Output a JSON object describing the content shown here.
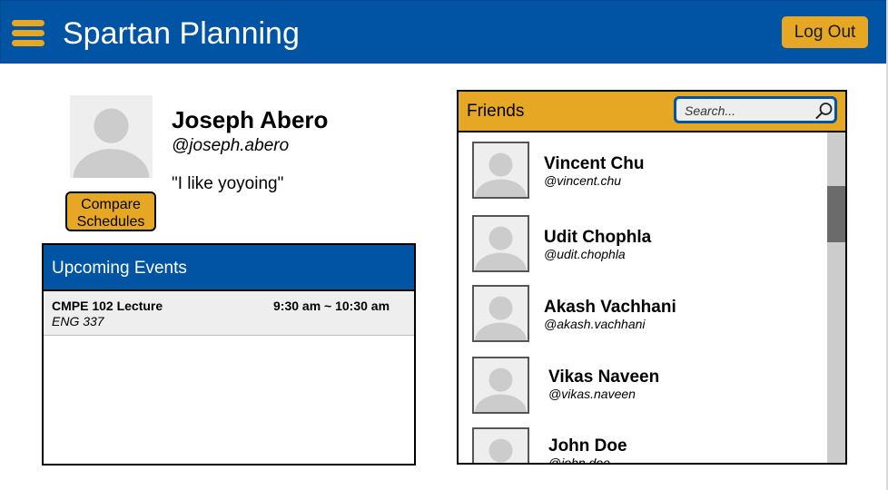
{
  "header": {
    "title": "Spartan Planning",
    "logout_label": "Log Out",
    "menu_icon": "hamburger-menu-icon"
  },
  "colors": {
    "primary_blue": "#0054a3",
    "accent_gold": "#e6a824",
    "panel_gray": "#eeeeee",
    "scrollbar_track": "#cccccc",
    "scrollbar_thumb": "#6b6b6b"
  },
  "profile": {
    "name": "Joseph Abero",
    "handle": "@joseph.abero",
    "bio": "\"I like yoyoing\"",
    "compare_line1": "Compare",
    "compare_line2": "Schedules",
    "avatar_icon": "user-avatar-icon"
  },
  "events": {
    "title": "Upcoming Events",
    "items": [
      {
        "title": "CMPE 102 Lecture",
        "location": "ENG 337",
        "time": "9:30 am ~ 10:30 am"
      }
    ]
  },
  "friends": {
    "title": "Friends",
    "search_placeholder": "Search...",
    "search_icon": "search-icon",
    "items": [
      {
        "name": "Vincent Chu",
        "handle": "@vincent.chu"
      },
      {
        "name": "Udit Chophla",
        "handle": "@udit.chophla"
      },
      {
        "name": "Akash Vachhani",
        "handle": "@akash.vachhani"
      },
      {
        "name": "Vikas Naveen",
        "handle": "@vikas.naveen"
      },
      {
        "name": "John Doe",
        "handle": "@john.doe"
      }
    ]
  }
}
